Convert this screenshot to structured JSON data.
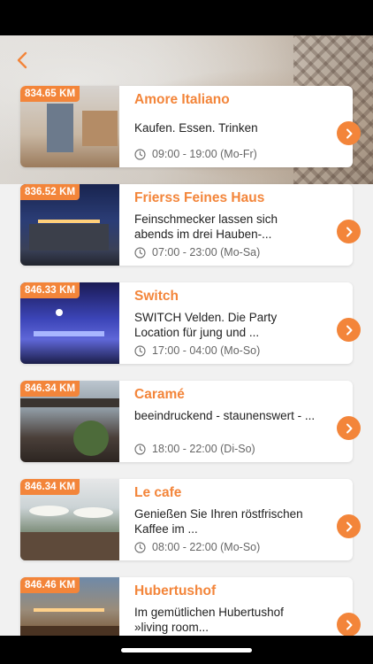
{
  "header": {
    "back_icon": "chevron-left-icon",
    "accent_color": "#f3853a"
  },
  "restaurants": [
    {
      "distance": "834.65 KM",
      "name": "Amore Italiano",
      "description": "Kaufen. Essen. Trinken",
      "hours": "09:00 - 19:00 (Mo-Fr)"
    },
    {
      "distance": "836.52 KM",
      "name": "Frierss Feines Haus",
      "description": "Feinschmecker lassen sich abends im drei Hauben-...",
      "hours": "07:00 - 23:00 (Mo-Sa)"
    },
    {
      "distance": "846.33 KM",
      "name": "Switch",
      "description": "SWITCH Velden. Die Party Location für jung und ...",
      "hours": "17:00 - 04:00 (Mo-So)"
    },
    {
      "distance": "846.34 KM",
      "name": "Caramé",
      "description": "beeindruckend - staunenswert - ...",
      "hours": "18:00 - 22:00 (Di-So)"
    },
    {
      "distance": "846.34 KM",
      "name": "Le cafe",
      "description": "Genießen Sie Ihren röstfrischen Kaffee im ...",
      "hours": "08:00 - 22:00 (Mo-So)"
    },
    {
      "distance": "846.46 KM",
      "name": "Hubertushof",
      "description": "Im gemütlichen Hubertushof »living room..."
    }
  ]
}
